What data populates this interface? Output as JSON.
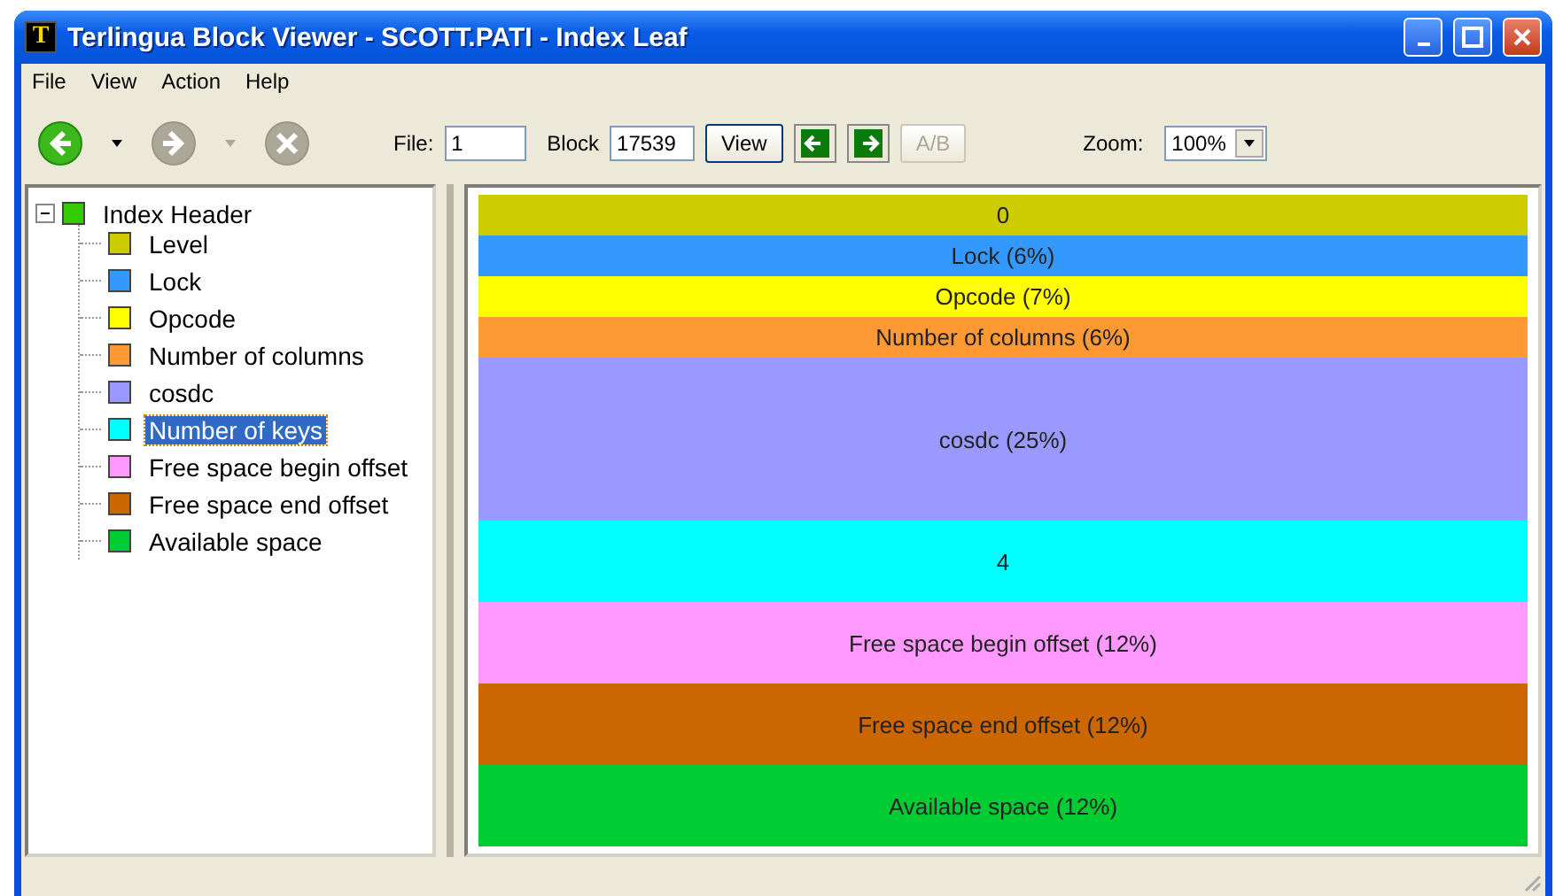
{
  "window": {
    "title": "Terlingua Block Viewer - SCOTT.PATI - Index Leaf",
    "app_letter": "T"
  },
  "menu": [
    "File",
    "View",
    "Action",
    "Help"
  ],
  "toolbar": {
    "back": {
      "disabled": false
    },
    "forward": {
      "disabled": true
    },
    "stop": {
      "disabled": true
    },
    "file_label": "File:",
    "file_value": "1",
    "block_label": "Block",
    "block_value": "17539",
    "view_button": "View",
    "prev": {
      "disabled": false
    },
    "next": {
      "disabled": false
    },
    "ab_button": {
      "label": "A/B",
      "disabled": true
    },
    "zoom_label": "Zoom:",
    "zoom_value": "100%"
  },
  "tree": {
    "label": "Index Header",
    "color": "#33cc00",
    "expanded": true,
    "selected": false,
    "children": [
      {
        "label": "Level",
        "color": "#cccc00",
        "selected": false
      },
      {
        "label": "Lock",
        "color": "#3399ff",
        "selected": false
      },
      {
        "label": "Opcode",
        "color": "#ffff00",
        "selected": false
      },
      {
        "label": "Number of columns",
        "color": "#ff9933",
        "selected": false
      },
      {
        "label": "cosdc",
        "color": "#9999ff",
        "selected": false
      },
      {
        "label": "Number of keys",
        "color": "#00ffff",
        "selected": true
      },
      {
        "label": "Free space begin offset",
        "color": "#ff99ff",
        "selected": false
      },
      {
        "label": "Free space end offset",
        "color": "#cc6600",
        "selected": false
      },
      {
        "label": "Available space",
        "color": "#00cc33",
        "selected": false
      }
    ]
  },
  "blocks": [
    {
      "label": "0",
      "color": "#cccc00",
      "kind": "small"
    },
    {
      "label": "Lock (6%)",
      "color": "#3399ff",
      "kind": "small"
    },
    {
      "label": "Opcode (7%)",
      "color": "#ffff00",
      "kind": "small"
    },
    {
      "label": "Number of columns (6%)",
      "color": "#ff9933",
      "kind": "small"
    },
    {
      "label": "cosdc (25%)",
      "color": "#9999ff",
      "kind": "large"
    },
    {
      "label": "4",
      "color": "#00ffff",
      "kind": "medium"
    },
    {
      "label": "Free space begin offset (12%)",
      "color": "#ff99ff",
      "kind": "medium"
    },
    {
      "label": "Free space end offset (12%)",
      "color": "#cc6600",
      "kind": "medium"
    },
    {
      "label": "Available space (12%)",
      "color": "#00cc33",
      "kind": "medium"
    }
  ]
}
